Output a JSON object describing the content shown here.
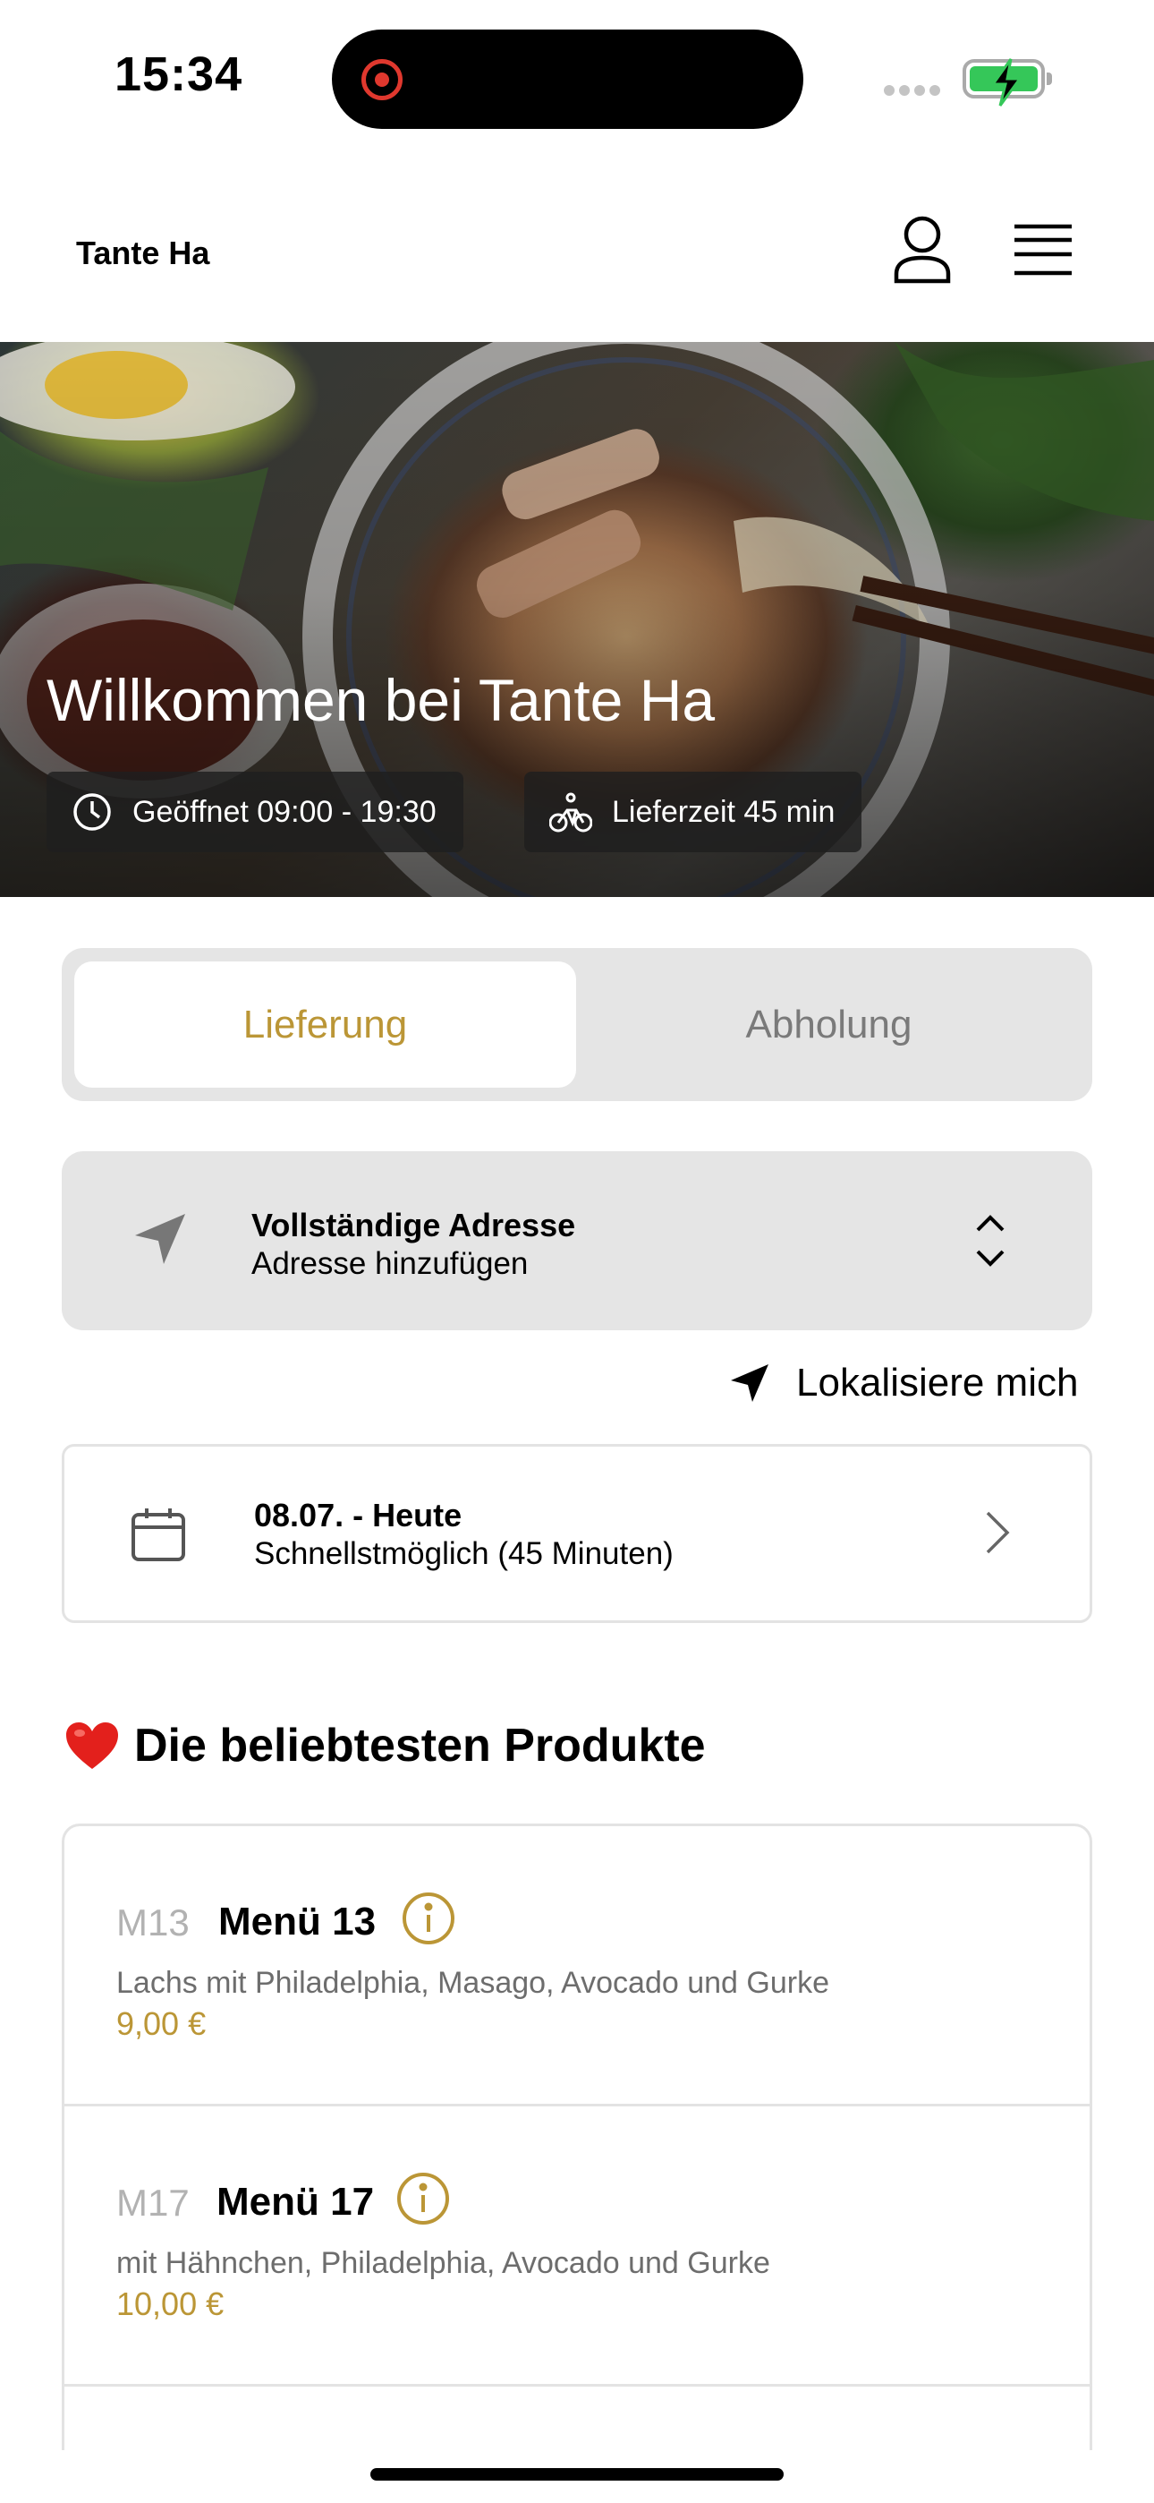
{
  "status_bar": {
    "time": "15:34"
  },
  "header": {
    "brand": "Tante Ha"
  },
  "hero": {
    "title": "Willkommen bei Tante Ha",
    "open_hours": "Geöffnet 09:00 - 19:30",
    "delivery_time": "Lieferzeit 45 min"
  },
  "order_mode": {
    "options": [
      "Lieferung",
      "Abholung"
    ],
    "selected": "Lieferung"
  },
  "address": {
    "title": "Vollständige Adresse",
    "subtitle": "Adresse hinzufügen"
  },
  "locate": {
    "label": "Lokalisiere mich"
  },
  "date": {
    "title": "08.07. - Heute",
    "subtitle": "Schnellstmöglich (45 Minuten)"
  },
  "popular": {
    "title": "Die beliebtesten Produkte",
    "products": [
      {
        "code": "M13",
        "name": "Menü 13",
        "description": "Lachs mit Philadelphia, Masago, Avocado und Gurke",
        "price": "9,00 €"
      },
      {
        "code": "M17",
        "name": "Menü 17",
        "description": "mit Hähnchen, Philadelphia, Avocado und Gurke",
        "price": "10,00 €"
      }
    ]
  },
  "colors": {
    "accent": "#bb9636",
    "segment_bg": "#e5e5e5",
    "muted_text": "#6d6d6d",
    "code_text": "#b2b2b2"
  }
}
